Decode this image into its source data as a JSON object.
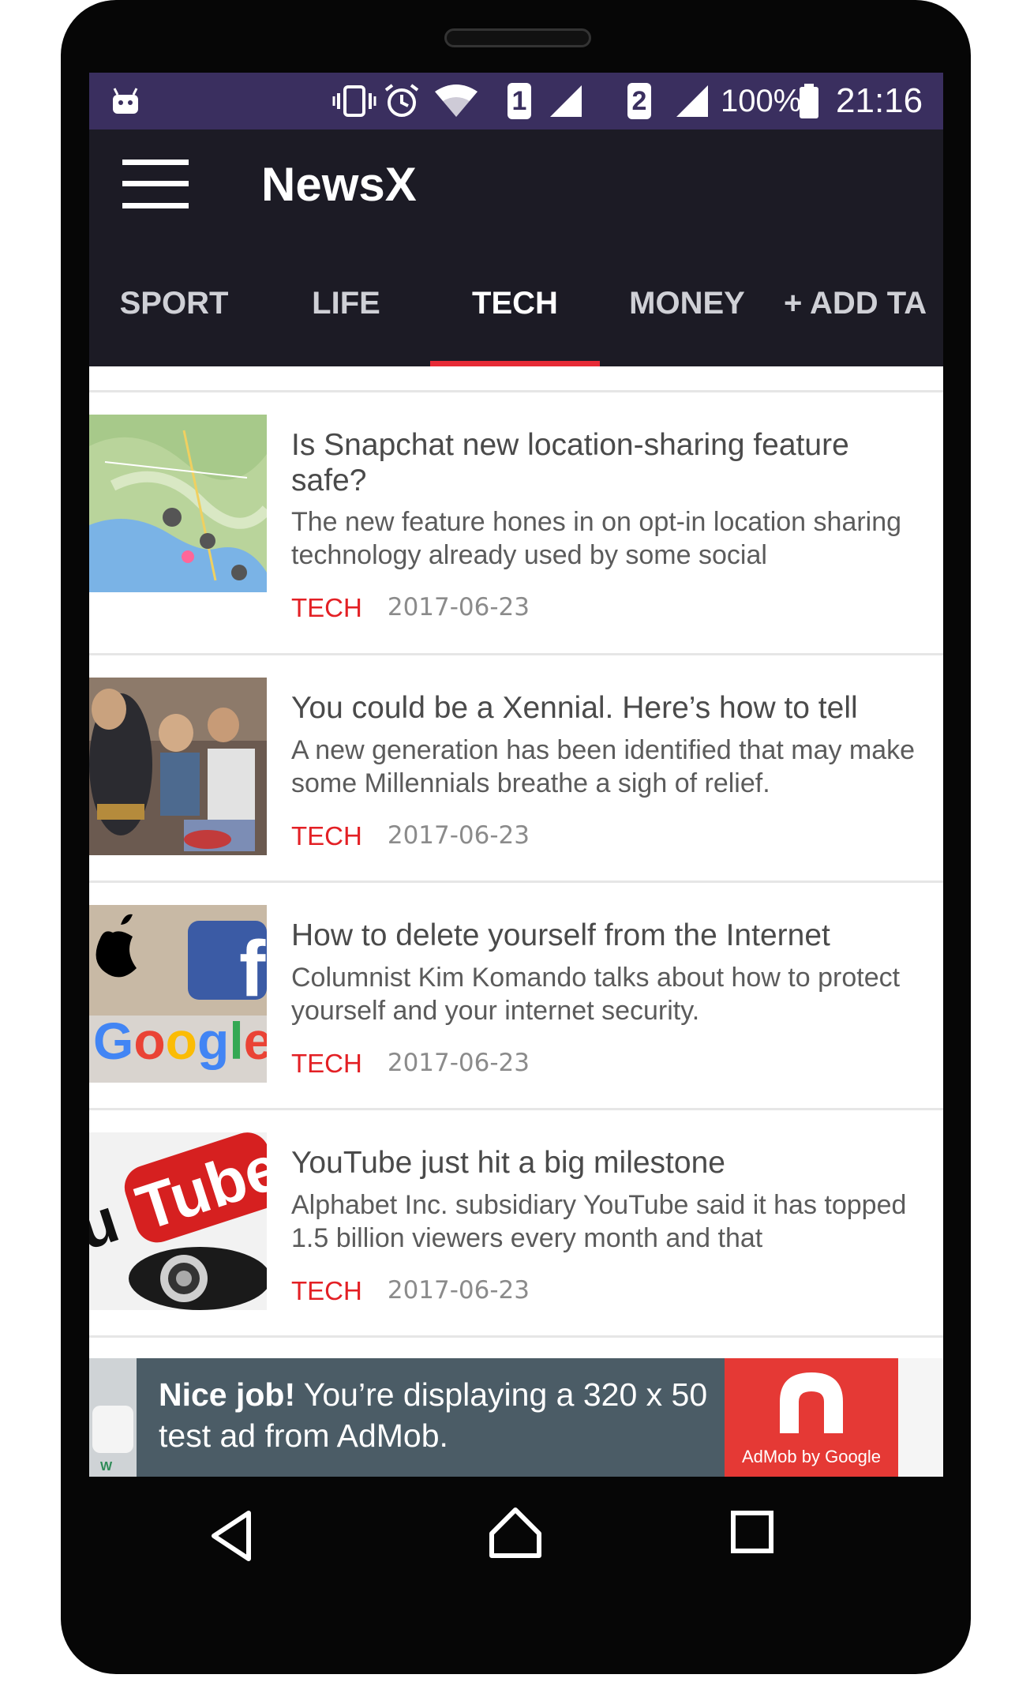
{
  "status_bar": {
    "sim1": "1",
    "sim2": "2",
    "battery": "100%",
    "time": "21:16",
    "icons": [
      "android-debug-icon",
      "vibrate-icon",
      "alarm-icon",
      "wifi-icon",
      "signal-icon",
      "battery-icon"
    ]
  },
  "app_bar": {
    "title": "NewsX",
    "menu_icon": "hamburger-menu-icon"
  },
  "tabs": [
    {
      "label": "SPORT"
    },
    {
      "label": "LIFE"
    },
    {
      "label": "TECH"
    },
    {
      "label": "MONEY"
    },
    {
      "label": "+ ADD TA"
    }
  ],
  "active_tab": "TECH",
  "colors": {
    "status_bar": "#3a2f5f",
    "app_bar": "#1c1b25",
    "tab_indicator": "#e62b36",
    "category": "#e32025",
    "ad_body": "#4b5c66",
    "ad_logo": "#e53935"
  },
  "articles": [
    {
      "title": "Is Snapchat new location-sharing feature safe?",
      "description": "The new feature hones in on opt-in location sharing technology already used by some social",
      "category": "TECH",
      "date": "2017-06-23",
      "thumbnail": "map-thumbnail"
    },
    {
      "title": "You could be a Xennial. Here’s how to tell",
      "description": "A new generation has been identified that may make some Millennials breathe a sigh of relief.",
      "category": "TECH",
      "date": "2017-06-23",
      "thumbnail": "crowd-thumbnail"
    },
    {
      "title": "How to delete yourself from the Internet",
      "description": "Columnist Kim Komando talks about how to protect yourself and your internet security.",
      "category": "TECH",
      "date": "2017-06-23",
      "thumbnail": "logos-thumbnail"
    },
    {
      "title": "YouTube just hit a big milestone",
      "description": "Alphabet Inc. subsidiary YouTube said it has topped 1.5 billion viewers every month and that",
      "category": "TECH",
      "date": "2017-06-23",
      "thumbnail": "youtube-thumbnail"
    }
  ],
  "ad": {
    "bold": "Nice job!",
    "text": " You’re displaying a 320 x 50 test ad from AdMob.",
    "logo_text": "AdMob by Google"
  },
  "nav": [
    "back-icon",
    "home-icon",
    "recents-icon"
  ]
}
